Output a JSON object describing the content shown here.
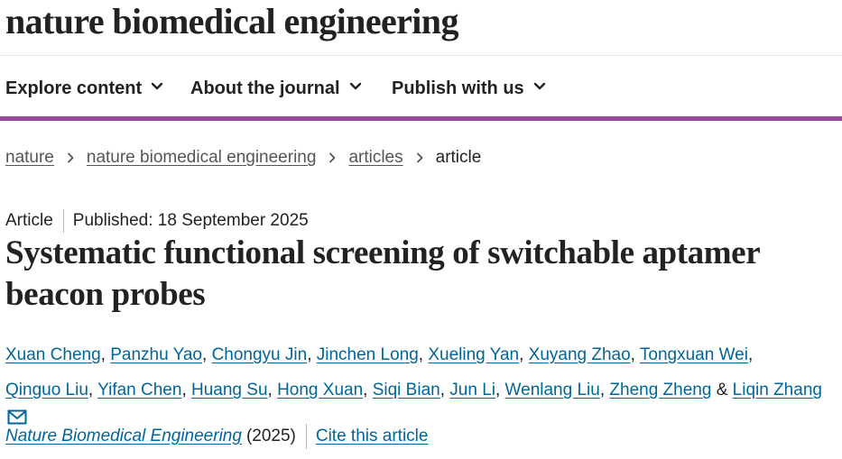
{
  "site": {
    "brand": "nature biomedical engineering"
  },
  "nav": {
    "items": [
      {
        "label": "Explore content",
        "icon": "chevron-down-icon"
      },
      {
        "label": "About the journal",
        "icon": "chevron-down-icon"
      },
      {
        "label": "Publish with us",
        "icon": "chevron-down-icon"
      }
    ]
  },
  "breadcrumb": {
    "items": [
      "nature",
      "nature biomedical engineering",
      "articles"
    ],
    "current": "article",
    "separator_icon": "chevron-right-icon"
  },
  "article": {
    "type": "Article",
    "published": "Published: 18 September 2025",
    "title": "Systematic functional screening of switchable aptamer beacon probes",
    "authors": [
      "Xuan Cheng",
      "Panzhu Yao",
      "Chongyu Jin",
      "Jinchen Long",
      "Xueling Yan",
      "Xuyang Zhao",
      "Tongxuan Wei",
      "Qinguo Liu",
      "Yifan Chen",
      "Huang Su",
      "Hong Xuan",
      "Siqi Bian",
      "Jun Li",
      "Wenlang Liu",
      "Zheng Zheng",
      "Liqin Zhang"
    ],
    "author_separator": ",",
    "final_conjunction": "&",
    "corresponding_icon": "mail-icon",
    "journal": "Nature Biomedical Engineering",
    "year": "(2025)",
    "cite_label": "Cite this article"
  },
  "colors": {
    "accent_bar": "#9b4a9b",
    "link": "#006699",
    "text": "#222222",
    "breadcrumb_link": "#555555"
  }
}
